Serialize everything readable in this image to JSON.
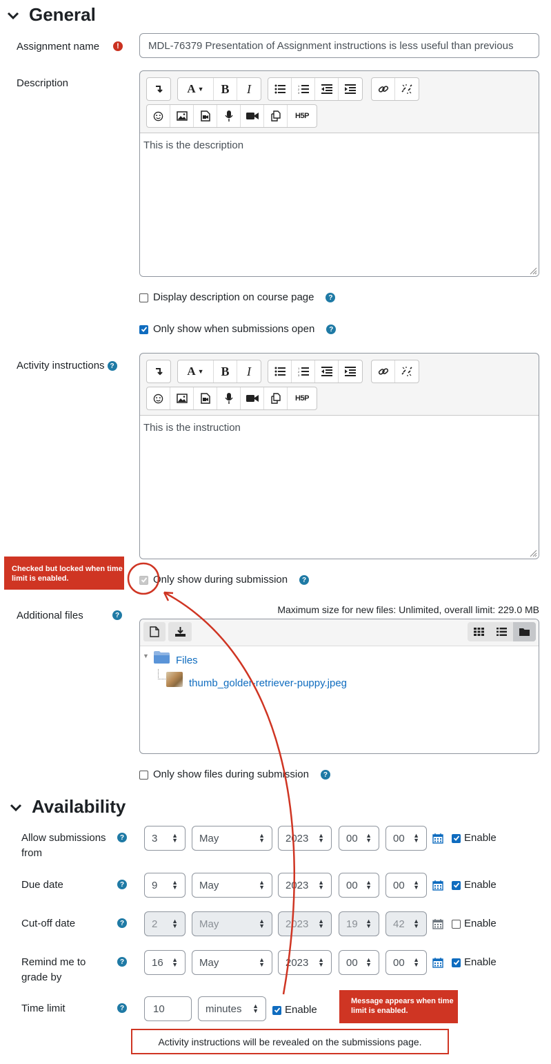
{
  "general": {
    "heading": "General",
    "assignment_name": {
      "label": "Assignment name",
      "value": "MDL-76379  Presentation of Assignment instructions is less useful than previous"
    },
    "description": {
      "label": "Description",
      "content": "This is the description"
    },
    "display_description": {
      "label": "Display description on course page",
      "checked": false
    },
    "only_show_when_open": {
      "label": "Only show when submissions open",
      "checked": true
    },
    "activity_instructions": {
      "label": "Activity instructions",
      "content": "This is the instruction"
    },
    "only_show_during_submission": {
      "label": "Only show during submission",
      "checked": true,
      "locked": true
    },
    "additional_files": {
      "label": "Additional files",
      "max_size": "Maximum size for new files: Unlimited, overall limit: 229.0 MB",
      "folder": "Files",
      "file": "thumb_golder-retriever-puppy.jpeg"
    },
    "only_show_files": {
      "label": "Only show files during submission",
      "checked": false
    }
  },
  "editor_toolbar": {
    "row1": [
      "collapse-icon",
      "font-style-icon",
      "bold-icon",
      "italic-icon",
      "unordered-list-icon",
      "ordered-list-icon",
      "outdent-icon",
      "indent-icon",
      "link-icon",
      "unlink-icon"
    ],
    "row2": [
      "emoji-icon",
      "image-icon",
      "media-icon",
      "record-audio-icon",
      "record-video-icon",
      "manage-files-icon",
      "h5p-icon"
    ],
    "bold": "B",
    "italic": "I",
    "font": "A",
    "h5p": "H5P"
  },
  "availability": {
    "heading": "Availability",
    "enable_label": "Enable",
    "rows": [
      {
        "label": "Allow submissions from",
        "day": "3",
        "month": "May",
        "year": "2023",
        "hour": "00",
        "minute": "00",
        "enabled": true
      },
      {
        "label": "Due date",
        "day": "9",
        "month": "May",
        "year": "2023",
        "hour": "00",
        "minute": "00",
        "enabled": true
      },
      {
        "label": "Cut-off date",
        "day": "2",
        "month": "May",
        "year": "2023",
        "hour": "19",
        "minute": "42",
        "enabled": false
      },
      {
        "label": "Remind me to grade by",
        "day": "16",
        "month": "May",
        "year": "2023",
        "hour": "00",
        "minute": "00",
        "enabled": true
      }
    ],
    "time_limit": {
      "label": "Time limit",
      "value": "10",
      "unit": "minutes",
      "enabled": true
    },
    "message": "Activity instructions will be revealed on the submissions page."
  },
  "annotations": {
    "locked_note": "Checked but locked when time limit is enabled.",
    "message_note": "Message appears when time limit is enabled."
  },
  "colors": {
    "accent": "#0f6cbf",
    "help": "#1f7aa5",
    "annotation": "#cf3523"
  }
}
